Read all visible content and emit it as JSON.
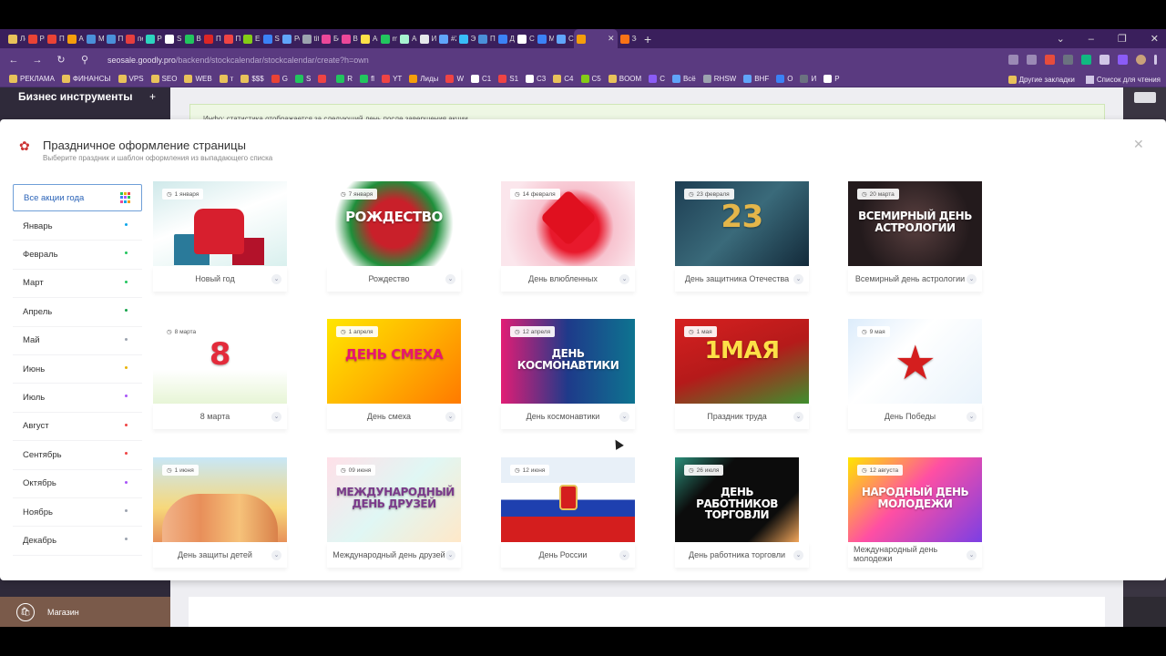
{
  "browser": {
    "tabs": [
      {
        "label": "Ле",
        "color": "#e8c25a"
      },
      {
        "label": "Ро",
        "color": "#ea4335"
      },
      {
        "label": "Пр",
        "color": "#ea4335"
      },
      {
        "label": "Ар",
        "color": "#f59e0b"
      },
      {
        "label": "М",
        "color": "#4a90d9"
      },
      {
        "label": "Пс",
        "color": "#4a90d9"
      },
      {
        "label": "пе",
        "color": "#e53e3e"
      },
      {
        "label": "Ро",
        "color": "#2dd4bf"
      },
      {
        "label": "SN",
        "color": "#ffffff"
      },
      {
        "label": "Вь",
        "color": "#22c55e"
      },
      {
        "label": "Пс",
        "color": "#dc2626"
      },
      {
        "label": "Пс",
        "color": "#ef4444"
      },
      {
        "label": "En",
        "color": "#84cc16"
      },
      {
        "label": "Sc",
        "color": "#3b82f6"
      },
      {
        "label": "Ре",
        "color": "#60a5fa"
      },
      {
        "label": "tit",
        "color": "#9ca3af"
      },
      {
        "label": "Бе",
        "color": "#ec4899"
      },
      {
        "label": "Вь",
        "color": "#ec4899"
      },
      {
        "label": "Ав",
        "color": "#fde047"
      },
      {
        "label": "m",
        "color": "#22c55e"
      },
      {
        "label": "Ак",
        "color": "#a7f3d0"
      },
      {
        "label": "Ин",
        "color": "#e5e7eb"
      },
      {
        "label": "#2",
        "color": "#60a5fa"
      },
      {
        "label": "Эл",
        "color": "#38bdf8"
      },
      {
        "label": "Пс",
        "color": "#4a90d9"
      },
      {
        "label": "Др",
        "color": "#3b82f6"
      },
      {
        "label": "Ст",
        "color": "#ffffff"
      },
      {
        "label": "Мі",
        "color": "#3b82f6"
      },
      {
        "label": "Сс",
        "color": "#60a5fa"
      },
      {
        "label": "",
        "color": "#f59e0b",
        "active": true
      },
      {
        "label": "Зс",
        "color": "#f97316"
      }
    ],
    "new_tab": "+",
    "window_controls": [
      "⌄",
      "–",
      "❐",
      "✕"
    ],
    "url_main": "seosale.goodly.pro",
    "url_path": "/backend/stockcalendar/stockcalendar/create?h=own",
    "bookmarks": [
      "РЕКЛАМА",
      "ФИНАНСЫ",
      "VPS",
      "SEO",
      "WEB",
      "т",
      "$$$",
      "G",
      "S",
      "",
      "R",
      "fl",
      "YT",
      "Лиды",
      "W",
      "C1",
      "S1",
      "C3",
      "C4",
      "C5",
      "BOOM",
      "С",
      "Всё",
      "RHSW",
      "BHF",
      "О",
      "И",
      "Р"
    ],
    "bookmarks_right": [
      "Другие закладки",
      "Список для чтения"
    ]
  },
  "app": {
    "sidebar_title": "Бизнес инструменты",
    "sidebar_add": "+",
    "info_text": "Инфо: статистика отображается за следующий день после завершения акции",
    "shop_label": "Магазин"
  },
  "modal": {
    "title": "Праздничное оформление страницы",
    "subtitle": "Выберите праздник и шаблон оформления из выпадающего списка",
    "close": "✕",
    "months": [
      {
        "label": "Все акции года",
        "active": true
      },
      {
        "label": "Январь",
        "dot": "#0ea5e9"
      },
      {
        "label": "Февраль",
        "dot": "#22c55e"
      },
      {
        "label": "Март",
        "dot": "#22c55e"
      },
      {
        "label": "Апрель",
        "dot": "#16a34a"
      },
      {
        "label": "Май",
        "dot": "#9ca3af"
      },
      {
        "label": "Июнь",
        "dot": "#eab308"
      },
      {
        "label": "Июль",
        "dot": "#a855f7"
      },
      {
        "label": "Август",
        "dot": "#ef4444"
      },
      {
        "label": "Сентябрь",
        "dot": "#ef4444"
      },
      {
        "label": "Октябрь",
        "dot": "#a855f7"
      },
      {
        "label": "Ноябрь",
        "dot": "#9ca3af"
      },
      {
        "label": "Декабрь",
        "dot": "#9ca3af"
      }
    ],
    "cards": [
      {
        "name": "Новый год",
        "date": "1 января",
        "big": "",
        "bg": "linear-gradient(160deg,#cfe9ea,#fff 45%,#d9f0ee)",
        "bigColor": "#fff"
      },
      {
        "name": "Рождество",
        "date": "7 января",
        "big": "РОЖДЕСТВО",
        "bg": "radial-gradient(circle at 50% 50%,#c9202a 0 30%,#1e8f3a 55%,#fff 75%)",
        "bigColor": "#fff"
      },
      {
        "name": "День влюбленных",
        "date": "14 февраля",
        "big": "",
        "bg": "radial-gradient(circle at 55% 55%,#e8192c 0 28%,#f7c3cf 45%,#fbe6ec 80%)",
        "bigColor": "#fff"
      },
      {
        "name": "День защитника Отечества",
        "date": "23 февраля",
        "big": "23",
        "bg": "linear-gradient(135deg,#1d3d52,#3a6a7a 50%,#132a3a)",
        "bigColor": "#e4b64a"
      },
      {
        "name": "Всемирный день астрологии",
        "date": "20 марта",
        "big": "ВСЕМИРНЫЙ ДЕНЬ АСТРОЛОГИИ",
        "bg": "radial-gradient(circle,#5a4040,#231a1c 70%)",
        "bigColor": "#fff"
      },
      {
        "name": "8 марта",
        "date": "8 марта",
        "big": "8",
        "bg": "linear-gradient(180deg,#fff,#fff 60%,#e7f5d6)",
        "bigColor": "#e32b3b"
      },
      {
        "name": "День смеха",
        "date": "1 апреля",
        "big": "ДЕНЬ СМЕХА",
        "bg": "linear-gradient(135deg,#ffe600,#ffb400 50%,#ff7a00)",
        "bigColor": "#e8166f"
      },
      {
        "name": "День космонавтики",
        "date": "12 апреля",
        "big": "ДЕНЬ КОСМОНАВТИКИ",
        "bg": "linear-gradient(90deg,#e11d75,#1e3a8a 50%,#0e7490)",
        "bigColor": "#fff"
      },
      {
        "name": "Праздник труда",
        "date": "1 мая",
        "big": "1МАЯ",
        "bg": "linear-gradient(160deg,#d62020,#b51a1a 50%,#3f8f2e)",
        "bigColor": "#fde047"
      },
      {
        "name": "День Победы",
        "date": "9 мая",
        "big": "★",
        "bg": "linear-gradient(135deg,#dcecfb,#fff 40%,#e9f3fb)",
        "bigColor": "#d41e1e"
      },
      {
        "name": "День защиты детей",
        "date": "1 июня",
        "big": "",
        "bg": "linear-gradient(180deg,#c8e7f7,#f7d87a 60%,#e8915a)",
        "bigColor": "#fff"
      },
      {
        "name": "Международный день друзей",
        "date": "09 июня",
        "big": "МЕЖДУНАРОДНЫЙ ДЕНЬ ДРУЗЕЙ",
        "bg": "linear-gradient(135deg,#ffe0e8,#e0f7f4 50%,#ffe8c8)",
        "bigColor": "#7a3a8a"
      },
      {
        "name": "День России",
        "date": "12 июня",
        "big": "",
        "bg": "linear-gradient(180deg,#e8f0f8 0 30%,#fff 30% 50%,#1e40af 50% 70%,#d41e1e 70%)",
        "bigColor": "#fff"
      },
      {
        "name": "День работника торговли",
        "date": "26 июля",
        "big": "ДЕНЬ РАБОТНИКОВ ТОРГОВЛИ",
        "bg": "linear-gradient(135deg,#2b8f7a,#0c0c0c 30% 75%,#f2a65a)",
        "bigColor": "#fff"
      },
      {
        "name": "Международный день молодежи",
        "date": "12 августа",
        "big": "НАРОДНЫЙ ДЕНЬ МОЛОДЕЖИ",
        "bg": "linear-gradient(135deg,#ffe600,#ff4fa3 45%,#7b3fe4)",
        "bigColor": "#fff"
      }
    ]
  },
  "icons": {
    "clock": "◷",
    "chevron": "⌄",
    "cart": "🛍"
  }
}
